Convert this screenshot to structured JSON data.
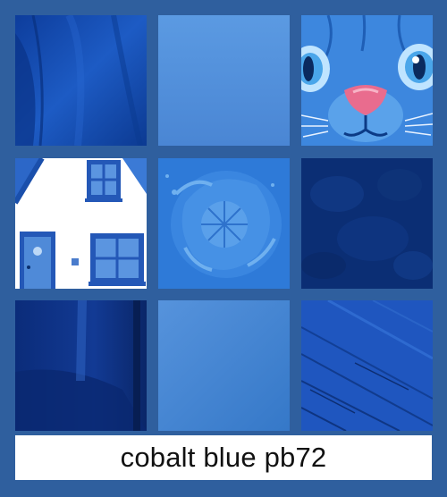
{
  "caption": {
    "text": "cobalt blue pb72"
  },
  "colors": {
    "frame": "#2f5f9e",
    "caption_background": "#ffffff",
    "caption_text": "#111111",
    "cobalt_dark": "#0b2f7a",
    "cobalt_mid": "#1f55b8",
    "cobalt_light": "#4f8ad8"
  },
  "tiles": [
    {
      "subject": "fabric-garment"
    },
    {
      "subject": "flat-swatch"
    },
    {
      "subject": "cat-face"
    },
    {
      "subject": "white-house"
    },
    {
      "subject": "paint-swirl"
    },
    {
      "subject": "dark-texture"
    },
    {
      "subject": "glossy-surface"
    },
    {
      "subject": "gradient-swatch"
    },
    {
      "subject": "wood-planks"
    }
  ]
}
